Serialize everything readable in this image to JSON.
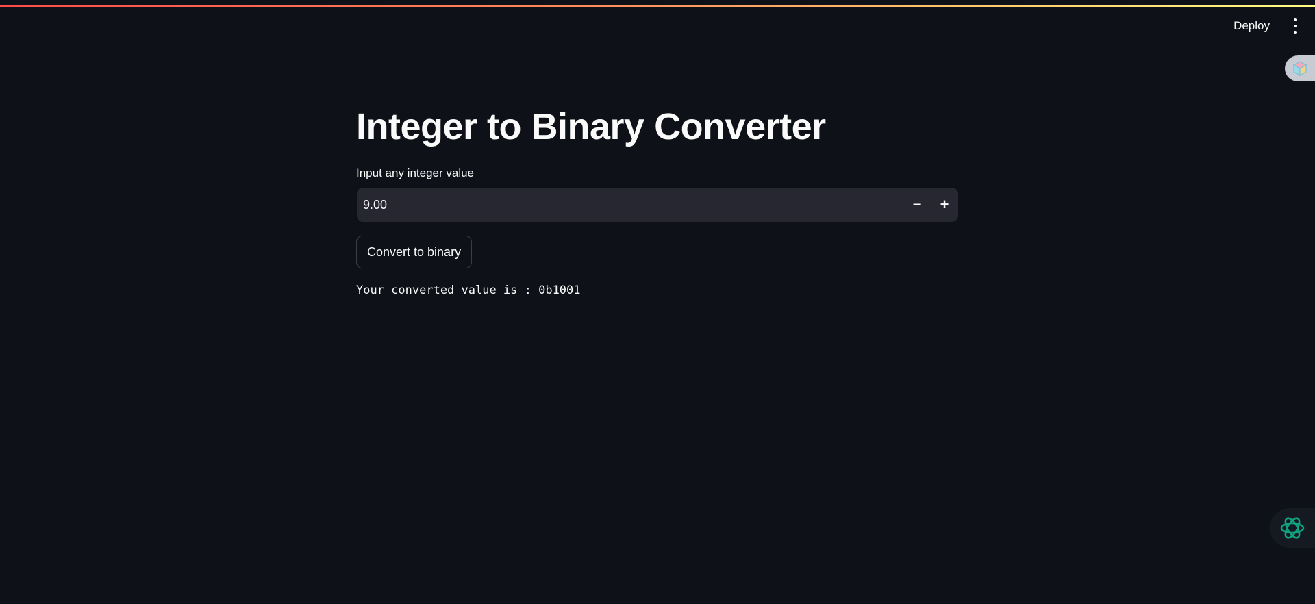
{
  "header": {
    "deploy_label": "Deploy",
    "menu_icon": "vertical-dots-icon",
    "gradient_colors": [
      "#ff4b4b",
      "#fffd80"
    ]
  },
  "side_badge": {
    "icon": "cube-icon"
  },
  "main": {
    "title": "Integer to Binary Converter",
    "input_label": "Input any integer value",
    "input_value": "9.00",
    "decrement_label": "−",
    "increment_label": "+",
    "convert_button_label": "Convert to binary",
    "result_text": "Your converted value is : 0b1001"
  },
  "assistant": {
    "icon": "ai-assistant-icon",
    "accent": "#10a37f"
  },
  "colors": {
    "background": "#0e1117",
    "input_background": "#262730",
    "text": "#fafafa"
  }
}
